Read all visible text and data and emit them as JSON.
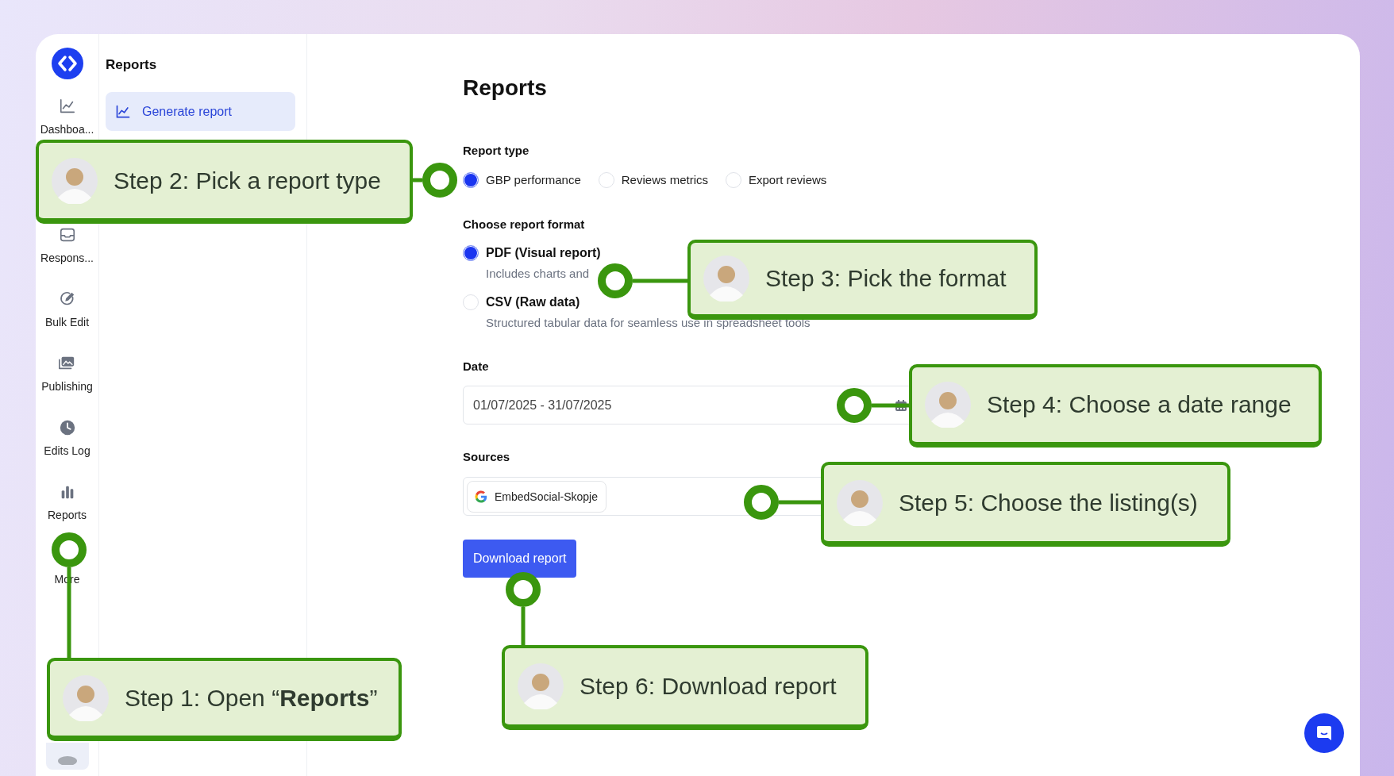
{
  "rail": {
    "items": [
      {
        "label": "Dashboa...",
        "kind": "chart"
      },
      {
        "label": "Respons...",
        "kind": "inbox"
      },
      {
        "label": "Bulk Edit",
        "kind": "edit"
      },
      {
        "label": "Publishing",
        "kind": "images"
      },
      {
        "label": "Edits Log",
        "kind": "clock"
      },
      {
        "label": "Reports",
        "kind": "bars"
      },
      {
        "label": "More",
        "kind": "more"
      }
    ]
  },
  "subnav": {
    "title": "Reports",
    "items": [
      {
        "label": "Generate report",
        "selected": true
      }
    ]
  },
  "main": {
    "title": "Reports",
    "report_type": {
      "label": "Report type",
      "options": [
        {
          "label": "GBP performance",
          "selected": true
        },
        {
          "label": "Reviews metrics",
          "selected": false
        },
        {
          "label": "Export reviews",
          "selected": false
        }
      ]
    },
    "report_format": {
      "label": "Choose report format",
      "options": [
        {
          "label": "PDF (Visual report)",
          "description": "Includes charts and",
          "selected": true
        },
        {
          "label": "CSV (Raw data)",
          "description": "Structured tabular data for seamless use in spreadsheet tools",
          "selected": false
        }
      ]
    },
    "date": {
      "label": "Date",
      "value": "01/07/2025 - 31/07/2025"
    },
    "sources": {
      "label": "Sources",
      "chips": [
        {
          "label": "EmbedSocial-Skopje"
        }
      ]
    },
    "download_button": "Download report"
  },
  "callouts": [
    {
      "text": "Step 2: Pick a report type"
    },
    {
      "text": "Step 3: Pick the format"
    },
    {
      "text": "Step 4: Choose a date range"
    },
    {
      "text": "Step 5: Choose the listing(s)"
    },
    {
      "text": "Step 1: Open “**Reports**”"
    },
    {
      "text": "Step 6: Download report"
    }
  ]
}
